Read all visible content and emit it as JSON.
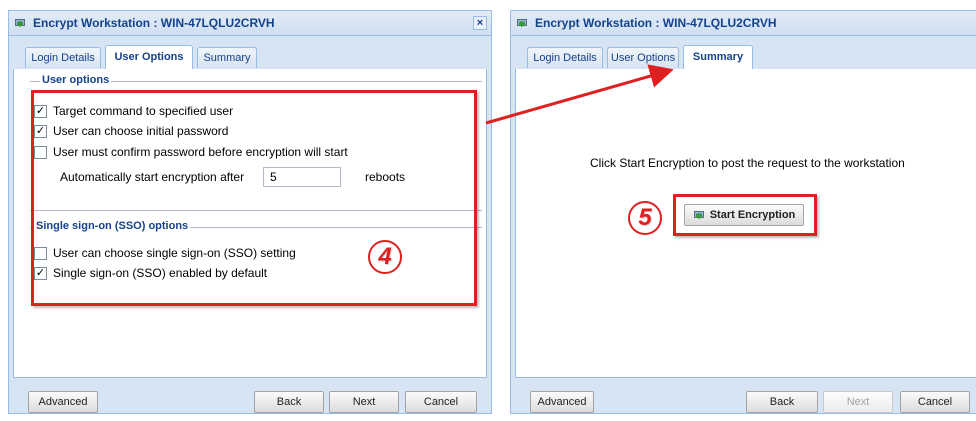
{
  "left_dialog": {
    "title": "Encrypt Workstation : WIN-47LQLU2CRVH",
    "close_glyph": "×",
    "tabs": [
      "Login Details",
      "User Options",
      "Summary"
    ],
    "active_tab": "User Options",
    "user_options": {
      "section_title": "User options",
      "checkboxes": [
        {
          "label": "Target command to specified user",
          "checked": true
        },
        {
          "label": "User can choose initial password",
          "checked": true
        },
        {
          "label": "User must confirm password before encryption will start",
          "checked": false
        }
      ],
      "auto_start_label": "Automatically start encryption after",
      "auto_start_value": "5",
      "auto_start_suffix": "reboots"
    },
    "sso_options": {
      "section_title": "Single sign-on (SSO) options",
      "checkboxes": [
        {
          "label": "User can choose single sign-on (SSO) setting",
          "checked": false
        },
        {
          "label": "Single sign-on (SSO) enabled by default",
          "checked": true
        }
      ]
    },
    "buttons": {
      "advanced": "Advanced",
      "back": "Back",
      "next": "Next",
      "cancel": "Cancel"
    },
    "annotation_step": "4"
  },
  "right_dialog": {
    "title": "Encrypt Workstation : WIN-47LQLU2CRVH",
    "tabs": [
      "Login Details",
      "User Options",
      "Summary"
    ],
    "active_tab": "Summary",
    "summary_text": "Click Start Encryption to post the request to the workstation",
    "start_button": "Start Encryption",
    "buttons": {
      "advanced": "Advanced",
      "back": "Back",
      "next": "Next",
      "cancel": "Cancel"
    },
    "next_disabled": true,
    "annotation_step": "5"
  },
  "colors": {
    "annotation_red": "#e02020",
    "title_blue": "#15428b",
    "panel_bg": "#d7e4f3",
    "border_blue": "#99bbe8"
  },
  "icons": {
    "title_icon": "shield-computer-icon",
    "start_icon": "shield-computer-icon"
  }
}
